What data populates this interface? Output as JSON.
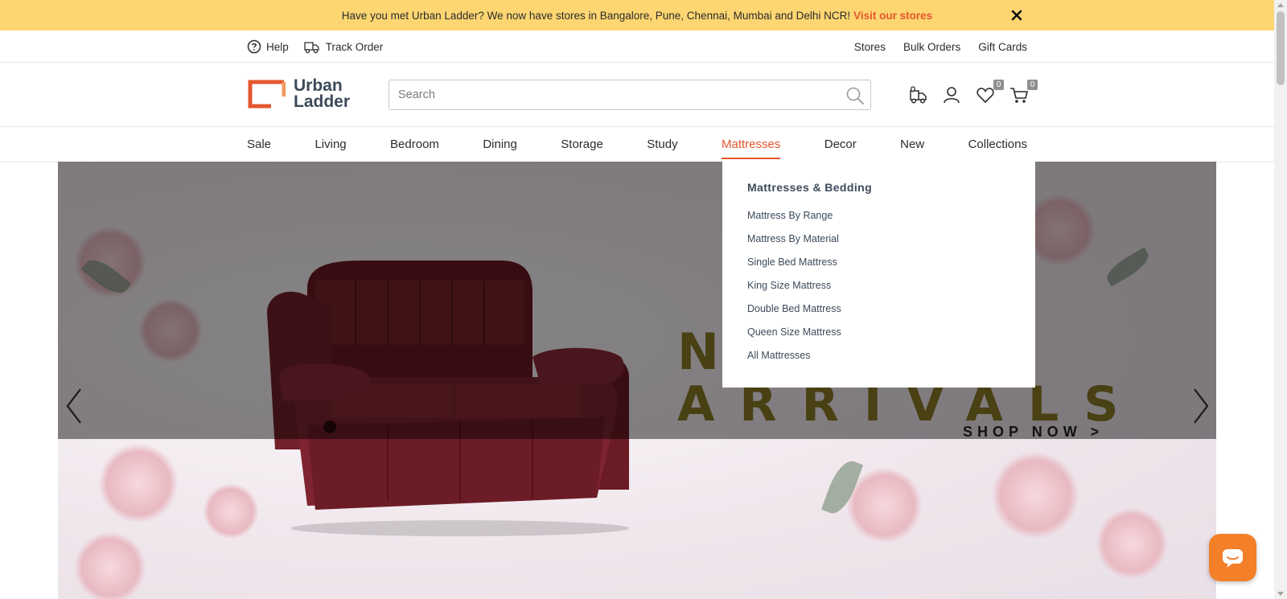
{
  "announcement": {
    "text": "Have you met Urban Ladder? We now have stores in Bangalore, Pune, Chennai, Mumbai and Delhi NCR!",
    "link": "Visit our stores",
    "close_icon": "close-icon"
  },
  "utility": {
    "help": "Help",
    "track_order": "Track Order",
    "stores": "Stores",
    "bulk_orders": "Bulk Orders",
    "gift_cards": "Gift Cards"
  },
  "header": {
    "logo_line1": "Urban",
    "logo_line2": "Ladder",
    "search_placeholder": "Search",
    "wishlist_count": "0",
    "cart_count": "0"
  },
  "nav": {
    "items": [
      "Sale",
      "Living",
      "Bedroom",
      "Dining",
      "Storage",
      "Study",
      "Mattresses",
      "Decor",
      "New",
      "Collections"
    ],
    "active": "Mattresses"
  },
  "dropdown": {
    "title": "Mattresses & Bedding",
    "items": [
      "Mattress By Range",
      "Mattress By Material",
      "Single Bed Mattress",
      "King Size Mattress",
      "Double Bed Mattress",
      "Queen Size Mattress",
      "All Mattresses"
    ]
  },
  "hero": {
    "headline_top": "NEW",
    "headline_main": "ARRIVALS",
    "cta": "SHOP NOW >"
  },
  "colors": {
    "accent": "#e4572e",
    "announce_bg": "#fdd672",
    "chat": "#f37f28",
    "headline": "#8a7a25"
  }
}
